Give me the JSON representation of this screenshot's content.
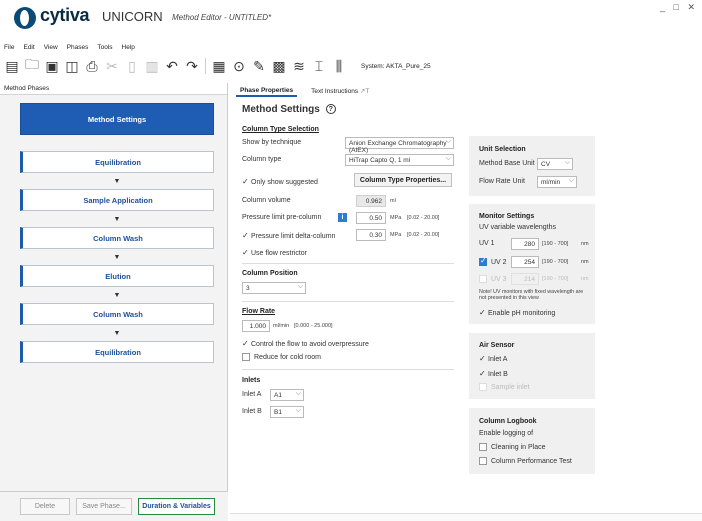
{
  "app": {
    "brand": "cytiva",
    "name": "UNICORN",
    "doc_title": "Method Editor - UNTITLED*",
    "window_controls": "_ □ ✕"
  },
  "menu": [
    "File",
    "Edit",
    "View",
    "Phases",
    "Tools",
    "Help"
  ],
  "toolbar": {
    "icons": [
      "new-method-icon",
      "open-folder-icon",
      "save-icon",
      "save-as-icon",
      "print-icon",
      "cut-icon",
      "copy-icon",
      "paste-icon",
      "undo-icon",
      "redo-icon",
      "method-settings-icon",
      "run-icon",
      "verify-icon",
      "instrument-icon",
      "settings-icon",
      "bracket-icon",
      "columns-icon"
    ],
    "system_label": "System: AKTA_Pure_25"
  },
  "left": {
    "header": "Method Phases",
    "phases": [
      "Method Settings",
      "Equilibration",
      "Sample Application",
      "Column Wash",
      "Elution",
      "Column Wash",
      "Equilibration"
    ],
    "arrow": "▼",
    "buttons": {
      "delete": "Delete",
      "save_phase": "Save Phase...",
      "duration": "Duration & Variables"
    }
  },
  "tabs": [
    "Phase Properties",
    "Text Instructions",
    "↗T"
  ],
  "main": {
    "title": "Method Settings",
    "help": "?",
    "column_type_selection": {
      "title": "Column Type Selection",
      "show_by_label": "Show by technique",
      "show_by_value": "Anion Exchange Chromatography (AIEX)",
      "column_type_label": "Column type",
      "column_type_value": "HiTrap Capto Q, 1 ml",
      "only_suggested": "Only show suggested",
      "properties_button": "Column Type Properties...",
      "column_volume_label": "Column volume",
      "column_volume_value": "0.962",
      "column_volume_unit": "ml",
      "pressure_pre_label": "Pressure limit pre-column",
      "pressure_pre_info": "i",
      "pressure_pre_value": "0.50",
      "pressure_pre_unit": "MPa",
      "pressure_pre_range": "[0.02 - 20.00]",
      "pressure_delta_label": "Pressure limit delta-column",
      "pressure_delta_value": "0.30",
      "pressure_delta_unit": "MPa",
      "pressure_delta_range": "[0.02 - 20.00]",
      "flow_restrictor": "Use flow restrictor"
    },
    "column_position": {
      "title": "Column Position",
      "value": "3"
    },
    "flow_rate": {
      "title": "Flow Rate",
      "value": "1.000",
      "unit": "ml/min",
      "range": "[0.000 - 25.000]",
      "control_overpressure": "Control the flow to avoid overpressure",
      "reduce_cold_room": "Reduce for cold room"
    },
    "inlets": {
      "title": "Inlets",
      "inlet_a_label": "Inlet A",
      "inlet_a_value": "A1",
      "inlet_b_label": "Inlet B",
      "inlet_b_value": "B1"
    }
  },
  "unit_selection": {
    "title": "Unit Selection",
    "base_unit_label": "Method Base Unit",
    "base_unit_value": "CV",
    "flow_rate_unit_label": "Flow Rate Unit",
    "flow_rate_unit_value": "ml/min"
  },
  "monitor_settings": {
    "title": "Monitor Settings",
    "subtitle": "UV variable wavelengths",
    "uv1_label": "UV 1",
    "uv1_value": "280",
    "uv1_range": "[190 - 700]",
    "uv1_unit": "nm",
    "uv2_label": "UV 2",
    "uv2_value": "254",
    "uv2_range": "[190 - 700]",
    "uv2_unit": "nm",
    "uv3_label": "UV 3",
    "uv3_value": "214",
    "uv3_range": "[190 - 700]",
    "uv3_unit": "nm",
    "note": "Note! UV monitors with fixed wavelength are not presented in this view",
    "ph_monitoring": "Enable pH monitoring"
  },
  "air_sensor": {
    "title": "Air Sensor",
    "inlet_a": "Inlet A",
    "inlet_b": "Inlet B",
    "sample_inlet": "Sample inlet"
  },
  "column_logbook": {
    "title": "Column Logbook",
    "subtitle": "Enable logging of",
    "cip": "Cleaning in Place",
    "performance": "Column Performance Test"
  },
  "colors": {
    "accent": "#1f5db4",
    "checkbox": "#2b7cd3",
    "card_bg": "#f0f0f0"
  }
}
